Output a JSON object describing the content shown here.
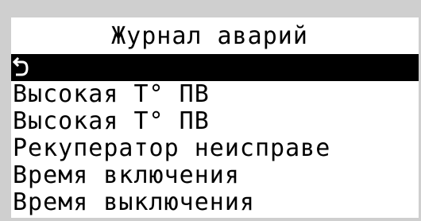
{
  "header": {
    "title": "Журнал аварий"
  },
  "menu": {
    "back_icon": "return-arrow-icon",
    "items": [
      {
        "label": "Высокая Т° ПВ"
      },
      {
        "label": "Высокая Т° ПВ"
      },
      {
        "label": "Рекуператор неисправе"
      },
      {
        "label": "Время включения"
      },
      {
        "label": "Время выключения"
      }
    ]
  },
  "colors": {
    "background": "#ffffff",
    "foreground": "#000000",
    "selection": "#000000",
    "bezel": "#cfcfcf"
  }
}
